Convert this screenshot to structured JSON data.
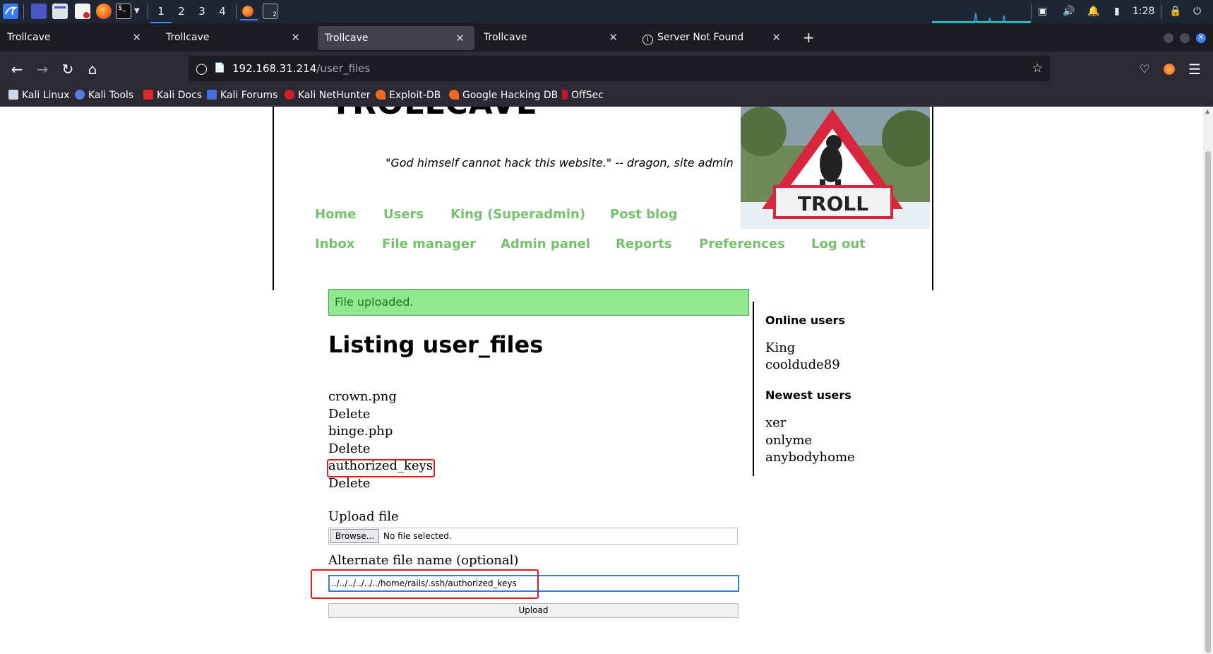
{
  "taskbar": {
    "workspaces": [
      "1",
      "2",
      "3",
      "4"
    ],
    "active_workspace": "1",
    "clock": "1:28",
    "icons": [
      "kali-menu-icon",
      "desktop-icon",
      "file-manager-icon",
      "text-editor-icon",
      "firefox-icon",
      "terminal-icon",
      "dropdown-icon"
    ],
    "colors": {
      "background": "#1f2633",
      "accent": "#3b82f6"
    }
  },
  "browser": {
    "tabs": [
      {
        "label": "Trollcave",
        "selected": false
      },
      {
        "label": "Trollcave",
        "selected": false
      },
      {
        "label": "Trollcave",
        "selected": true
      },
      {
        "label": "Trollcave",
        "selected": false
      },
      {
        "label": "Server Not Found",
        "selected": false
      }
    ],
    "new_tab_label": "+",
    "url_host": "192.168.31.214",
    "url_path": "/user_files",
    "bookmarks": [
      "Kali Linux",
      "Kali Tools",
      "Kali Docs",
      "Kali Forums",
      "Kali NetHunter",
      "Exploit-DB",
      "Google Hacking DB",
      "OffSec"
    ]
  },
  "site": {
    "title": "TROLLCAVE",
    "tagline": "\"God himself cannot hack this website.\" -- dragon, site admin",
    "image_text": "TROLL",
    "menu_row1": [
      "Home",
      "Users",
      "King (Superadmin)",
      "Post blog"
    ],
    "menu_row2": [
      "Inbox",
      "File manager",
      "Admin panel",
      "Reports",
      "Preferences",
      "Log out"
    ],
    "link_color": "#77c06d"
  },
  "main": {
    "flash": "File uploaded.",
    "heading": "Listing user_files",
    "files": [
      {
        "name": "crown.png",
        "action": "Delete"
      },
      {
        "name": "binge.php",
        "action": "Delete"
      },
      {
        "name": "authorized_keys",
        "action": "Delete"
      }
    ],
    "upload_label": "Upload file",
    "browse_label": "Browse...",
    "no_file_text": "No file selected.",
    "alt_label": "Alternate file name (optional)",
    "alt_value": "../../../../../../home/rails/.ssh/authorized_keys",
    "upload_button": "Upload"
  },
  "sidebar": {
    "online_heading": "Online users",
    "online_users": [
      "King",
      "cooldude89"
    ],
    "newest_heading": "Newest users",
    "newest_users": [
      "xer",
      "onlyme",
      "anybodyhome"
    ]
  }
}
